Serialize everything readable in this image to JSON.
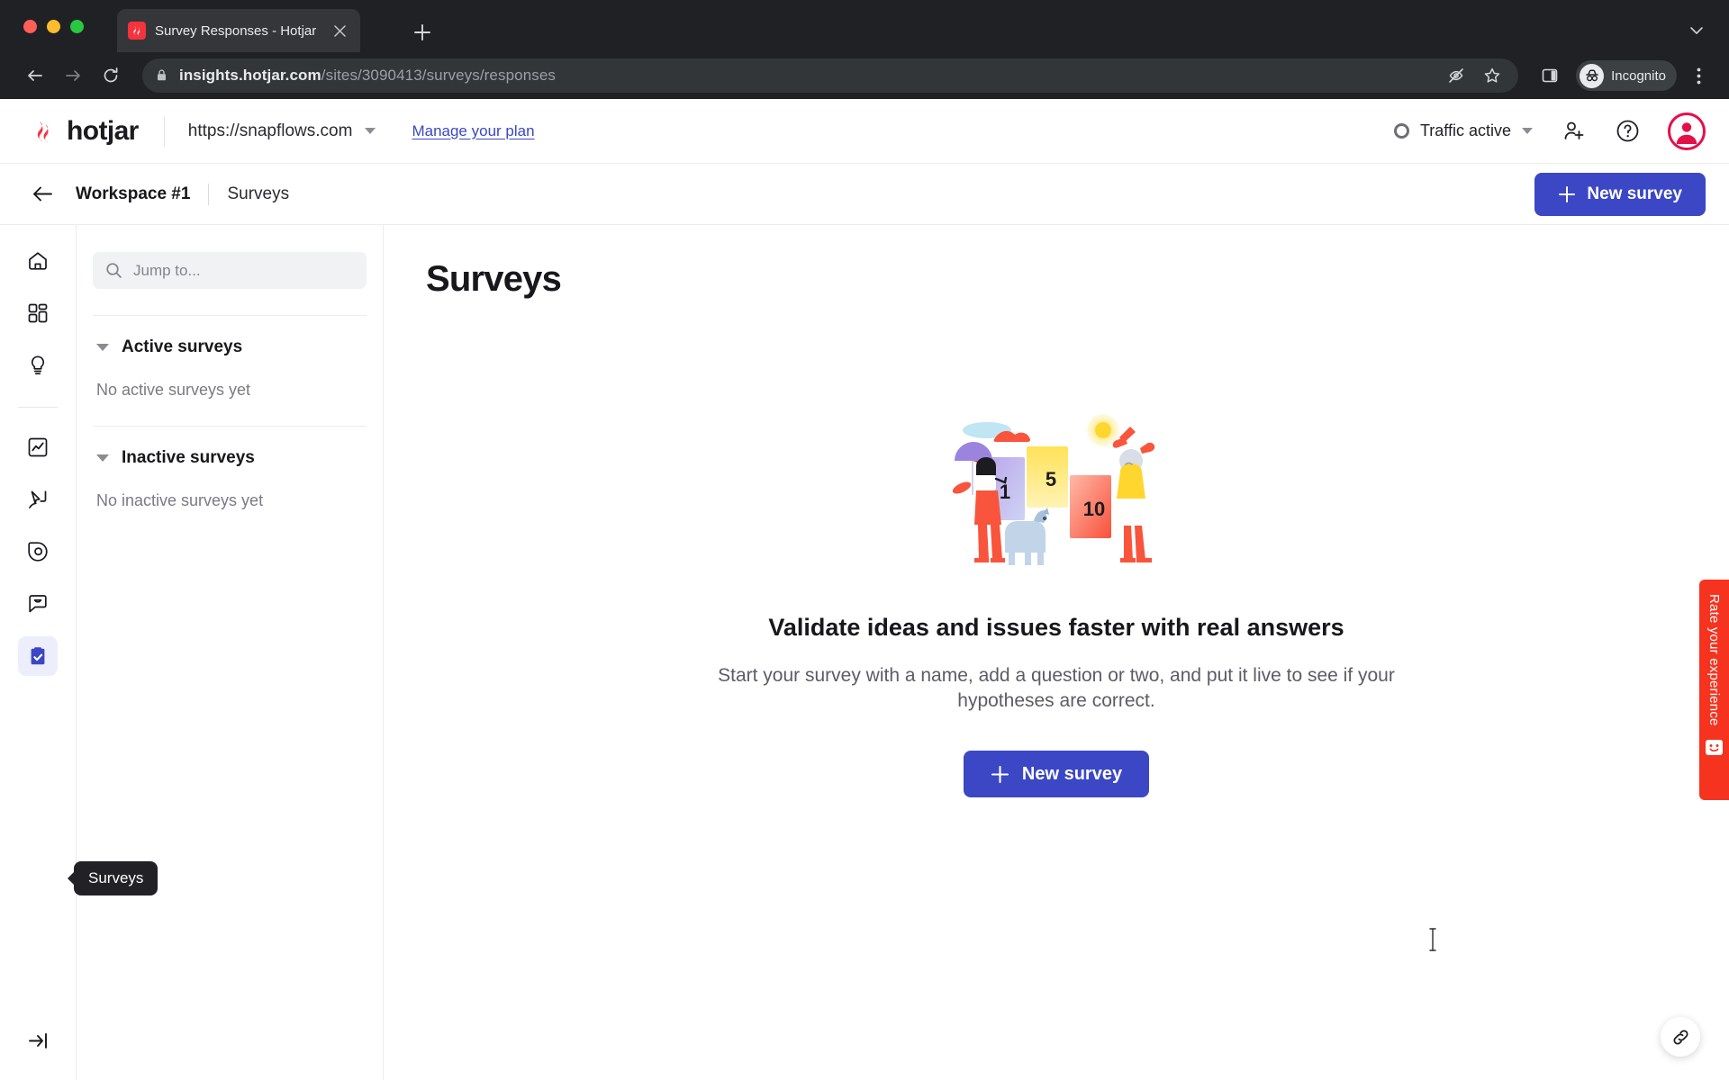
{
  "browser": {
    "tab": {
      "title": "Survey Responses - Hotjar",
      "favicon": "hotjar-favicon",
      "close_icon": "close-icon"
    },
    "new_tab_icon": "plus-icon",
    "tab_list_icon": "chevron-down-icon",
    "nav": {
      "back_icon": "back-arrow-icon",
      "forward_icon": "forward-arrow-icon",
      "reload_icon": "reload-icon"
    },
    "omnibox": {
      "lock_icon": "lock-icon",
      "url_bold": "insights.hotjar.com",
      "url_dim": "/sites/3090413/surveys/responses",
      "full_url": "insights.hotjar.com/sites/3090413/surveys/responses",
      "icons": [
        "eye-off-icon",
        "star-icon",
        "side-panel-icon"
      ]
    },
    "profile": {
      "label": "Incognito",
      "avatar_icon": "incognito-icon"
    },
    "menu_icon": "kebab-menu-icon"
  },
  "header": {
    "brand": "hotjar",
    "site_url": "https://snapflows.com",
    "site_caret_icon": "chevron-down-icon",
    "manage_plan": "Manage your plan",
    "traffic_status": "Traffic active",
    "traffic_caret_icon": "chevron-down-icon",
    "invite_icon": "add-user-icon",
    "help_icon": "question-mark-icon",
    "avatar_icon": "user-avatar-icon",
    "accent_red": "#e5104a"
  },
  "breadcrumb": {
    "back_icon": "back-arrow-icon",
    "workspace": "Workspace #1",
    "current": "Surveys",
    "new_survey_label": "New survey",
    "new_survey_icon": "plus-icon",
    "button_color": "#3b47c4"
  },
  "rail": {
    "items": [
      {
        "name": "home",
        "icon": "home-icon",
        "active": false
      },
      {
        "name": "dashboards",
        "icon": "dashboard-grid-icon",
        "active": false
      },
      {
        "name": "highlights",
        "icon": "lightbulb-icon",
        "active": false
      },
      {
        "name": "trends",
        "icon": "trends-chart-icon",
        "active": false
      },
      {
        "name": "funnels",
        "icon": "funnel-cursor-icon",
        "active": false
      },
      {
        "name": "recordings",
        "icon": "recordings-pin-icon",
        "active": false
      },
      {
        "name": "feedback",
        "icon": "feedback-bubble-icon",
        "active": false
      },
      {
        "name": "surveys",
        "icon": "clipboard-check-icon",
        "active": true
      }
    ],
    "collapse_icon": "collapse-panel-icon",
    "tooltip": "Surveys",
    "active_bg": "#eceefb",
    "active_icon_color": "#3b47c4"
  },
  "list_panel": {
    "search_placeholder": "Jump to...",
    "search_value": "",
    "search_icon": "search-icon",
    "groups": [
      {
        "title": "Active surveys",
        "empty": "No active surveys yet",
        "caret_icon": "caret-down-icon"
      },
      {
        "title": "Inactive surveys",
        "empty": "No inactive surveys yet",
        "caret_icon": "caret-down-icon"
      }
    ]
  },
  "main": {
    "page_title": "Surveys",
    "illustration": {
      "name": "survey-rating-illustration",
      "labels": [
        "1",
        "5",
        "10"
      ]
    },
    "empty_title": "Validate ideas and issues faster with real answers",
    "empty_sub": "Start your survey with a name, add a question or two, and put it live to see if your hypotheses are correct.",
    "cta_label": "New survey",
    "cta_icon": "plus-icon"
  },
  "rate_widget": {
    "label": "Rate your experience",
    "icon": "smiley-face-icon",
    "color": "#f5331f"
  },
  "link_bubble": {
    "icon": "link-chain-icon"
  }
}
